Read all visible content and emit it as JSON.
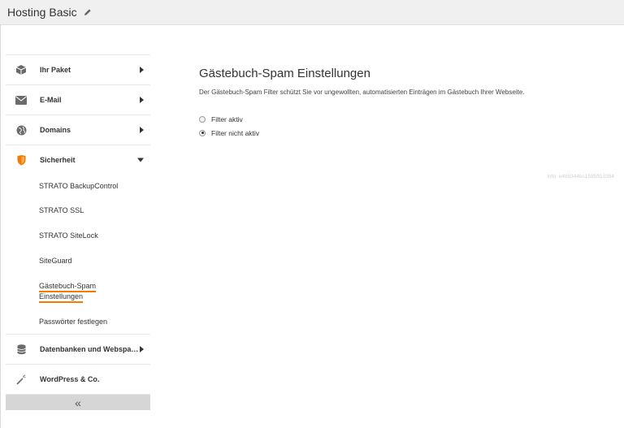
{
  "header": {
    "title": "Hosting Basic",
    "edit_icon": "pencil-icon"
  },
  "sidebar": {
    "items": [
      {
        "label": "Ihr Paket",
        "icon": "box-icon",
        "arrow": "chevron-right"
      },
      {
        "label": "E-Mail",
        "icon": "envelope-icon",
        "arrow": "chevron-right"
      },
      {
        "label": "Domains",
        "icon": "globe-icon",
        "arrow": "chevron-right"
      },
      {
        "label": "Sicherheit",
        "icon": "shield-icon",
        "arrow": "chevron-down",
        "accent": "#f07d00"
      },
      {
        "label": "Datenbanken und Webspace",
        "icon": "database-icon",
        "arrow": "chevron-right"
      },
      {
        "label": "WordPress & Co.",
        "icon": "magic-wand-icon"
      }
    ],
    "subitems": [
      {
        "label": "STRATO BackupControl"
      },
      {
        "label": "STRATO SSL"
      },
      {
        "label": "STRATO SiteLock"
      },
      {
        "label": "SiteGuard"
      },
      {
        "label_line1": "Gästebuch-Spam",
        "label_line2": "Einstellungen",
        "active": true
      },
      {
        "label": "Passwörter festlegen"
      }
    ],
    "collapse_label": "«"
  },
  "main": {
    "title": "Gästebuch-Spam Einstellungen",
    "description": "Der Gästebuch-Spam Filter schützt Sie vor ungewollten, automatisierten Einträgen im Gästebuch Ihrer Webseite.",
    "options": [
      {
        "label": "Filter aktiv",
        "checked": false
      },
      {
        "label": "Filter nicht aktiv",
        "checked": true
      }
    ],
    "info": "Info: e488344bs1585913384"
  },
  "colors": {
    "accent": "#f07d00",
    "icon_gray": "#6b6b6b"
  }
}
